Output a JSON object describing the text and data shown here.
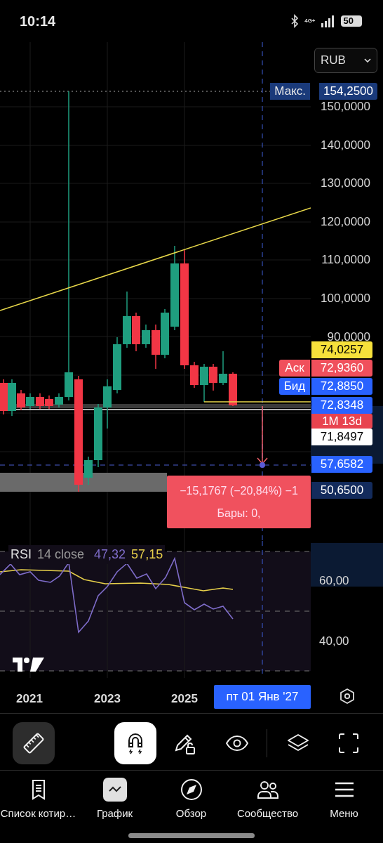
{
  "status_bar": {
    "time": "10:14",
    "network": "4G+",
    "battery": "50"
  },
  "currency_select": {
    "value": "RUB"
  },
  "price_axis": {
    "max_label": "Макс.",
    "max_value": "154,2500",
    "ticks": [
      "150,0000",
      "140,0000",
      "130,0000",
      "120,0000",
      "110,0000",
      "100,0000",
      "90,0000"
    ],
    "markers": [
      {
        "value": "74,0257",
        "color": "#f7e13b"
      },
      {
        "tag": "Аск",
        "value": "72,9360",
        "color": "#f0505c"
      },
      {
        "tag": "Бид",
        "value": "72,8850",
        "color": "#2962ff"
      },
      {
        "value": "72,8348",
        "color": "#2962ff"
      },
      {
        "value": "1M 13d",
        "color": "#e8434f"
      },
      {
        "value": "71,8497",
        "color": "#ffffff"
      },
      {
        "value": "57,6582",
        "color": "#2962ff"
      },
      {
        "value": "50,6500",
        "color": "#132b5c"
      }
    ]
  },
  "measurement": {
    "change": "−15,1767 (−20,84%) −1",
    "bars": "Бары: 0,"
  },
  "rsi": {
    "title": "RSI",
    "params": "14 close",
    "value": "47,32",
    "ma_value": "57,15",
    "ticks": [
      "60,00",
      "40,00"
    ]
  },
  "time_axis": {
    "labels": [
      "2021",
      "2023",
      "2025"
    ],
    "crosshair_label": "пт 01 Янв '27"
  },
  "toolbar": [
    {
      "kind": "ruler",
      "active": true,
      "selected": false
    },
    {
      "kind": "magnet",
      "active": false,
      "selected": true
    },
    {
      "kind": "pencil-lock",
      "active": false,
      "selected": false
    },
    {
      "kind": "eye",
      "active": false,
      "selected": false
    },
    {
      "kind": "layers",
      "active": false,
      "selected": false
    },
    {
      "kind": "fullscreen",
      "active": false,
      "selected": false
    }
  ],
  "nav": [
    {
      "kind": "watchlist",
      "label": "Список котир…",
      "selected": false
    },
    {
      "kind": "chart",
      "label": "График",
      "selected": true
    },
    {
      "kind": "explore",
      "label": "Обзор",
      "selected": false
    },
    {
      "kind": "community",
      "label": "Сообщество",
      "selected": false
    },
    {
      "kind": "menu",
      "label": "Меню",
      "selected": false
    }
  ]
}
